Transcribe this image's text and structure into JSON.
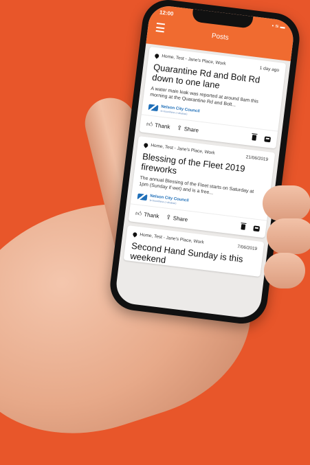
{
  "status_bar": {
    "time": "12:00",
    "icons": "▪ ≋ ▬"
  },
  "header": {
    "title": "Posts",
    "menu_icon": "hamburger-icon"
  },
  "posts": [
    {
      "location": "Home, Test - Jane's Place, Work",
      "date": "1 day ago",
      "title": "Quarantine Rd and Bolt Rd down to one lane",
      "body": "A water main leak was reported at around 8am this morning at the Quarantine Rd and Bolt...",
      "logo_text": "Nelson City Council",
      "logo_sub": "te kaunihera o whakatū",
      "thank_label": "Thank",
      "share_label": "Share"
    },
    {
      "location": "Home, Test - Jane's Place, Work",
      "date": "21/06/2019",
      "title": "Blessing of the Fleet 2019 fireworks",
      "body": "The annual Blessing of the Fleet starts on Saturday at 1pm (Sunday if wet) and is a free...",
      "logo_text": "Nelson City Council",
      "logo_sub": "te kaunihera o whakatū",
      "thank_label": "Thank",
      "share_label": "Share"
    },
    {
      "location": "Home, Test - Jane's Place, Work",
      "date": "7/06/2019",
      "title": "Second Hand Sunday is this weekend"
    }
  ],
  "colors": {
    "background": "#e8562a",
    "header": "#f06b30",
    "logo": "#1f6fb8"
  }
}
